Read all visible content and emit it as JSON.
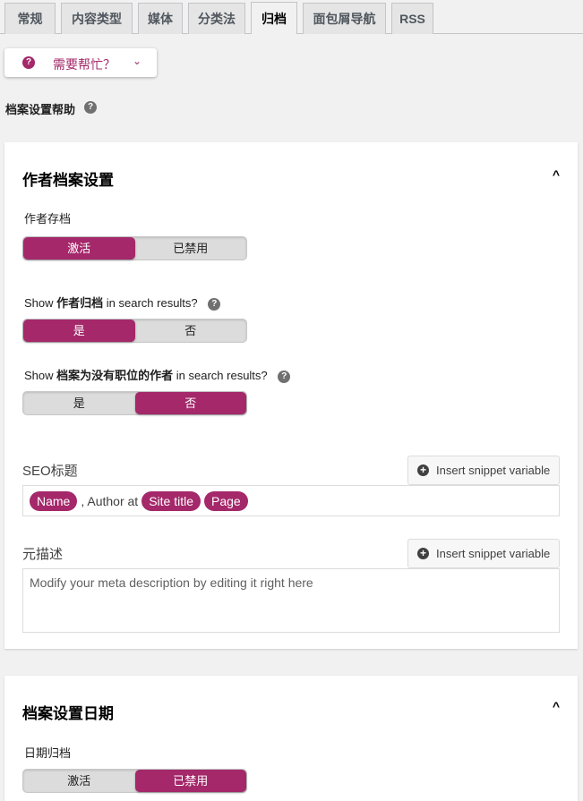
{
  "tabs": [
    {
      "label": "常规",
      "active": false
    },
    {
      "label": "内容类型",
      "active": false
    },
    {
      "label": "媒体",
      "active": false
    },
    {
      "label": "分类法",
      "active": false
    },
    {
      "label": "归档",
      "active": true
    },
    {
      "label": "面包屑导航",
      "active": false
    },
    {
      "label": "RSS",
      "active": false
    }
  ],
  "help_button": {
    "icon": "?",
    "label": "需要帮忙？",
    "chevron": "⌄"
  },
  "page_help": {
    "label": "档案设置帮助",
    "icon": "?"
  },
  "author_card": {
    "title": "作者档案设置",
    "collapse_icon": "^",
    "author_archives": {
      "label": "作者存档",
      "options": [
        "激活",
        "已禁用"
      ],
      "selected": "激活"
    },
    "show_in_search": {
      "prefix": "Show ",
      "bold": "作者归档",
      "suffix": " in search results?",
      "help_icon": "?",
      "options": [
        "是",
        "否"
      ],
      "selected": "是"
    },
    "show_no_posts": {
      "prefix": "Show ",
      "bold": "档案为没有职位的作者",
      "suffix": " in search results?",
      "help_icon": "?",
      "options": [
        "是",
        "否"
      ],
      "selected": "否"
    },
    "seo_title": {
      "label": "SEO标题",
      "insert_button": "Insert snippet variable",
      "parts": [
        {
          "type": "pill",
          "text": "Name"
        },
        {
          "type": "text",
          "text": ", Author at"
        },
        {
          "type": "pill",
          "text": "Site title"
        },
        {
          "type": "pill",
          "text": "Page"
        }
      ]
    },
    "meta_description": {
      "label": "元描述",
      "insert_button": "Insert snippet variable",
      "placeholder": "Modify your meta description by editing it right here"
    }
  },
  "date_card": {
    "title": "档案设置日期",
    "collapse_icon": "^",
    "date_archives": {
      "label": "日期归档",
      "options": [
        "激活",
        "已禁用"
      ],
      "selected": "已禁用"
    }
  },
  "colors": {
    "accent": "#a4286a",
    "background": "#f1f1f1"
  }
}
